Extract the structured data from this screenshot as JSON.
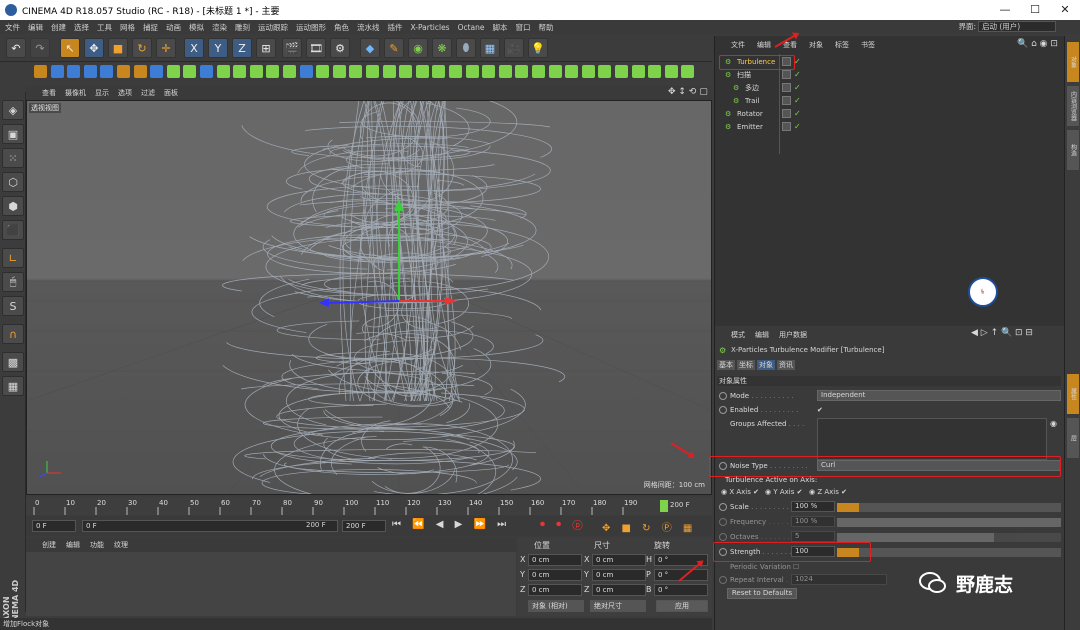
{
  "window": {
    "title": "CINEMA 4D R18.057 Studio (RC - R18) - [未标题 1 *] - 主要",
    "min": "—",
    "max": "☐",
    "close": "✕"
  },
  "menubar": {
    "items": [
      "文件",
      "编辑",
      "创建",
      "选择",
      "工具",
      "网格",
      "捕捉",
      "动画",
      "模拟",
      "渲染",
      "雕刻",
      "运动跟踪",
      "运动图形",
      "角色",
      "流水线",
      "插件",
      "X-Particles",
      "Octane",
      "脚本",
      "窗口",
      "帮助"
    ],
    "layout_label": "界面:",
    "layout_value": "启动 (用户)"
  },
  "viewport": {
    "menu": [
      "查看",
      "摄像机",
      "显示",
      "选项",
      "过滤",
      "面板"
    ],
    "label": "透视视图",
    "grid_label": "网格间距：100 cm"
  },
  "timeline": {
    "ticks": [
      "0",
      "10",
      "20",
      "30",
      "40",
      "50",
      "60",
      "70",
      "80",
      "90",
      "100",
      "110",
      "120",
      "130",
      "140",
      "150",
      "160",
      "170",
      "180",
      "190"
    ],
    "end_frame": "200 F",
    "current": "0 F",
    "start": "0 F",
    "range_end": "200 F",
    "max": "200 F"
  },
  "material": {
    "menu": [
      "创建",
      "编辑",
      "功能",
      "纹理"
    ]
  },
  "coords": {
    "headers": [
      "位置",
      "尺寸",
      "旋转"
    ],
    "rows": [
      {
        "a": "X",
        "pos": "0 cm",
        "b": "X",
        "size": "0 cm",
        "c": "H",
        "rot": "0 °"
      },
      {
        "a": "Y",
        "pos": "0 cm",
        "b": "Y",
        "size": "0 cm",
        "c": "P",
        "rot": "0 °"
      },
      {
        "a": "Z",
        "pos": "0 cm",
        "b": "Z",
        "size": "0 cm",
        "c": "B",
        "rot": "0 °"
      }
    ],
    "mode1": "对象 (相对)",
    "mode2": "绝对尺寸",
    "apply": "应用"
  },
  "status": "增加Flock对象",
  "object_manager": {
    "menu": [
      "文件",
      "编辑",
      "查看",
      "对象",
      "标签",
      "书签"
    ],
    "objects": [
      {
        "name": "Turbulence",
        "indent": 0
      },
      {
        "name": "扫描",
        "indent": 0
      },
      {
        "name": "多边",
        "indent": 1
      },
      {
        "name": "Trail",
        "indent": 1
      },
      {
        "name": "Rotator",
        "indent": 0
      },
      {
        "name": "Emitter",
        "indent": 0
      }
    ]
  },
  "attribute_manager": {
    "menu": [
      "模式",
      "编辑",
      "用户数据"
    ],
    "title": "X-Particles Turbulence Modifier [Turbulence]",
    "tabs": [
      "基本",
      "坐标",
      "对象",
      "资讯"
    ],
    "section": "对象属性",
    "mode_label": "Mode",
    "mode_value": "Independent",
    "enabled_label": "Enabled",
    "groups_label": "Groups Affected",
    "noise_label": "Noise Type",
    "noise_value": "Curl",
    "axis_label": "Turbulence Active on Axis:",
    "axes": [
      "X Axis",
      "Y Axis",
      "Z Axis"
    ],
    "scale_label": "Scale",
    "scale_value": "100 %",
    "scale_fraction": 0.1,
    "frequency_label": "Frequency",
    "frequency_value": "100 %",
    "frequency_fraction": 1.0,
    "octaves_label": "Octaves",
    "octaves_value": "5",
    "octaves_fraction": 0.7,
    "strength_label": "Strength",
    "strength_value": "100",
    "strength_fraction": 0.1,
    "periodic_label": "Periodic Variation",
    "repeat_label": "Repeat Interval",
    "repeat_value": "1024",
    "reset_label": "Reset to Defaults"
  },
  "side_tabs": [
    "对象",
    "内容浏览器",
    "构造",
    "属性",
    "层"
  ],
  "watermark": {
    "text": "野鹿志"
  },
  "colors": {
    "accent": "#e02020",
    "check": "#7fd34a",
    "selected": "#c8861f"
  }
}
